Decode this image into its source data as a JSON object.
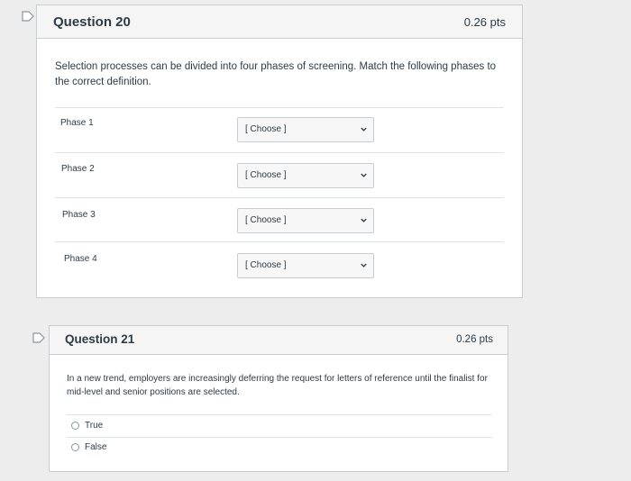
{
  "q20": {
    "title": "Question 20",
    "points": "0.26 pts",
    "text": "Selection processes can be divided into four phases of screening. Match the following phases to the correct definition.",
    "rows": [
      {
        "label": "Phase 1",
        "selected": "[ Choose ]"
      },
      {
        "label": "Phase 2",
        "selected": "[ Choose ]"
      },
      {
        "label": "Phase 3",
        "selected": "[ Choose ]"
      },
      {
        "label": "Phase 4",
        "selected": "[ Choose ]"
      }
    ]
  },
  "q21": {
    "title": "Question 21",
    "points": "0.26 pts",
    "text": "In a new trend, employers are increasingly deferring the request for letters of reference until the finalist for mid-level and senior positions are selected.",
    "answers": [
      {
        "label": "True"
      },
      {
        "label": "False"
      }
    ]
  },
  "colors": {
    "background": "#ededed",
    "card_border": "#c7cdd1",
    "header_bg": "#f5f5f5",
    "text": "#2d3b45"
  }
}
